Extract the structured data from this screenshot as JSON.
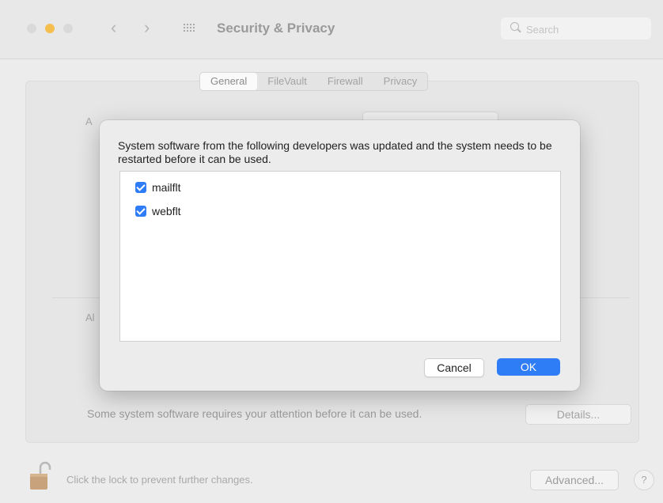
{
  "window": {
    "title": "Security & Privacy",
    "search": {
      "placeholder": "Search",
      "value": ""
    }
  },
  "tabs": [
    {
      "label": "General",
      "selected": true
    },
    {
      "label": "FileVault",
      "selected": false
    },
    {
      "label": "Firewall",
      "selected": false
    },
    {
      "label": "Privacy",
      "selected": false
    }
  ],
  "background": {
    "attention_text": "Some system software requires your attention before it can be used.",
    "details_label": "Details..."
  },
  "footer": {
    "lock_text": "Click the lock to prevent further changes.",
    "advanced_label": "Advanced...",
    "help_label": "?"
  },
  "dialog": {
    "message": "System software from the following developers was updated and the system needs to be restarted before it can be used.",
    "items": [
      {
        "label": "mailflt",
        "checked": true
      },
      {
        "label": "webflt",
        "checked": true
      }
    ],
    "cancel_label": "Cancel",
    "ok_label": "OK"
  },
  "colors": {
    "accent": "#2f7df6",
    "minimize": "#f5bf4f"
  }
}
